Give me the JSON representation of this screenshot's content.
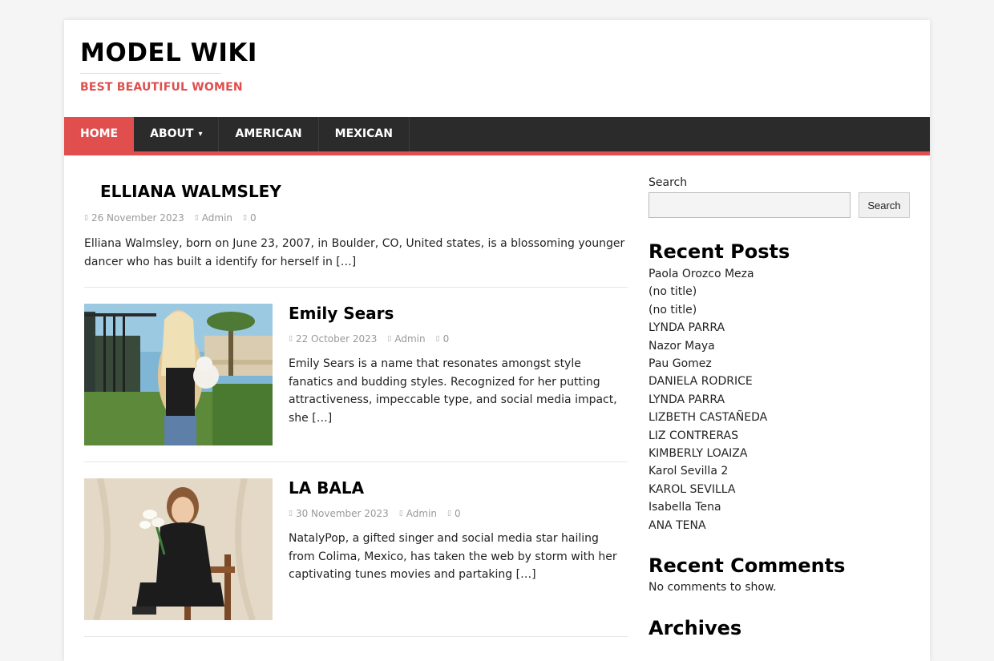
{
  "site": {
    "title": "MODEL WIKI",
    "tagline": "BEST BEAUTIFUL WOMEN"
  },
  "nav": {
    "items": [
      {
        "label": "HOME"
      },
      {
        "label": "ABOUT"
      },
      {
        "label": "AMERICAN"
      },
      {
        "label": "MEXICAN"
      }
    ]
  },
  "posts": [
    {
      "title": "ELLIANA WALMSLEY",
      "date": "26 November 2023",
      "author": "Admin",
      "comments": "0",
      "excerpt": "Elliana Walmsley, born on June 23, 2007, in Boulder, CO, United states, is a blossoming younger dancer who has built a identify for herself in […]"
    },
    {
      "title": "Emily Sears",
      "date": "22 October 2023",
      "author": "Admin",
      "comments": "0",
      "excerpt": "Emily Sears is a name that resonates amongst style fanatics and budding styles. Recognized for her putting attractiveness, impeccable type, and social media impact, she […]"
    },
    {
      "title": "LA BALA",
      "date": "30 November 2023",
      "author": "Admin",
      "comments": "0",
      "excerpt": "NatalyPop, a gifted singer and social media star hailing from Colima, Mexico, has taken the web by storm with her captivating tunes movies and partaking […]"
    }
  ],
  "sidebar": {
    "search_label": "Search",
    "search_button": "Search",
    "recent_posts_title": "Recent Posts",
    "recent_posts": [
      "Paola Orozco Meza",
      "(no title)",
      "(no title)",
      "LYNDA PARRA",
      "Nazor Maya",
      "Pau Gomez",
      "DANIELA RODRICE",
      "LYNDA PARRA",
      "LIZBETH CASTAÑEDA",
      "LIZ CONTRERAS",
      "KIMBERLY LOAIZA",
      "Karol Sevilla 2",
      "KAROL SEVILLA",
      "Isabella Tena",
      "ANA TENA"
    ],
    "recent_comments_title": "Recent Comments",
    "no_comments": "No comments to show.",
    "archives_title": "Archives"
  },
  "colors": {
    "accent": "#e04e4e",
    "nav_bg": "#2b2b2b"
  }
}
